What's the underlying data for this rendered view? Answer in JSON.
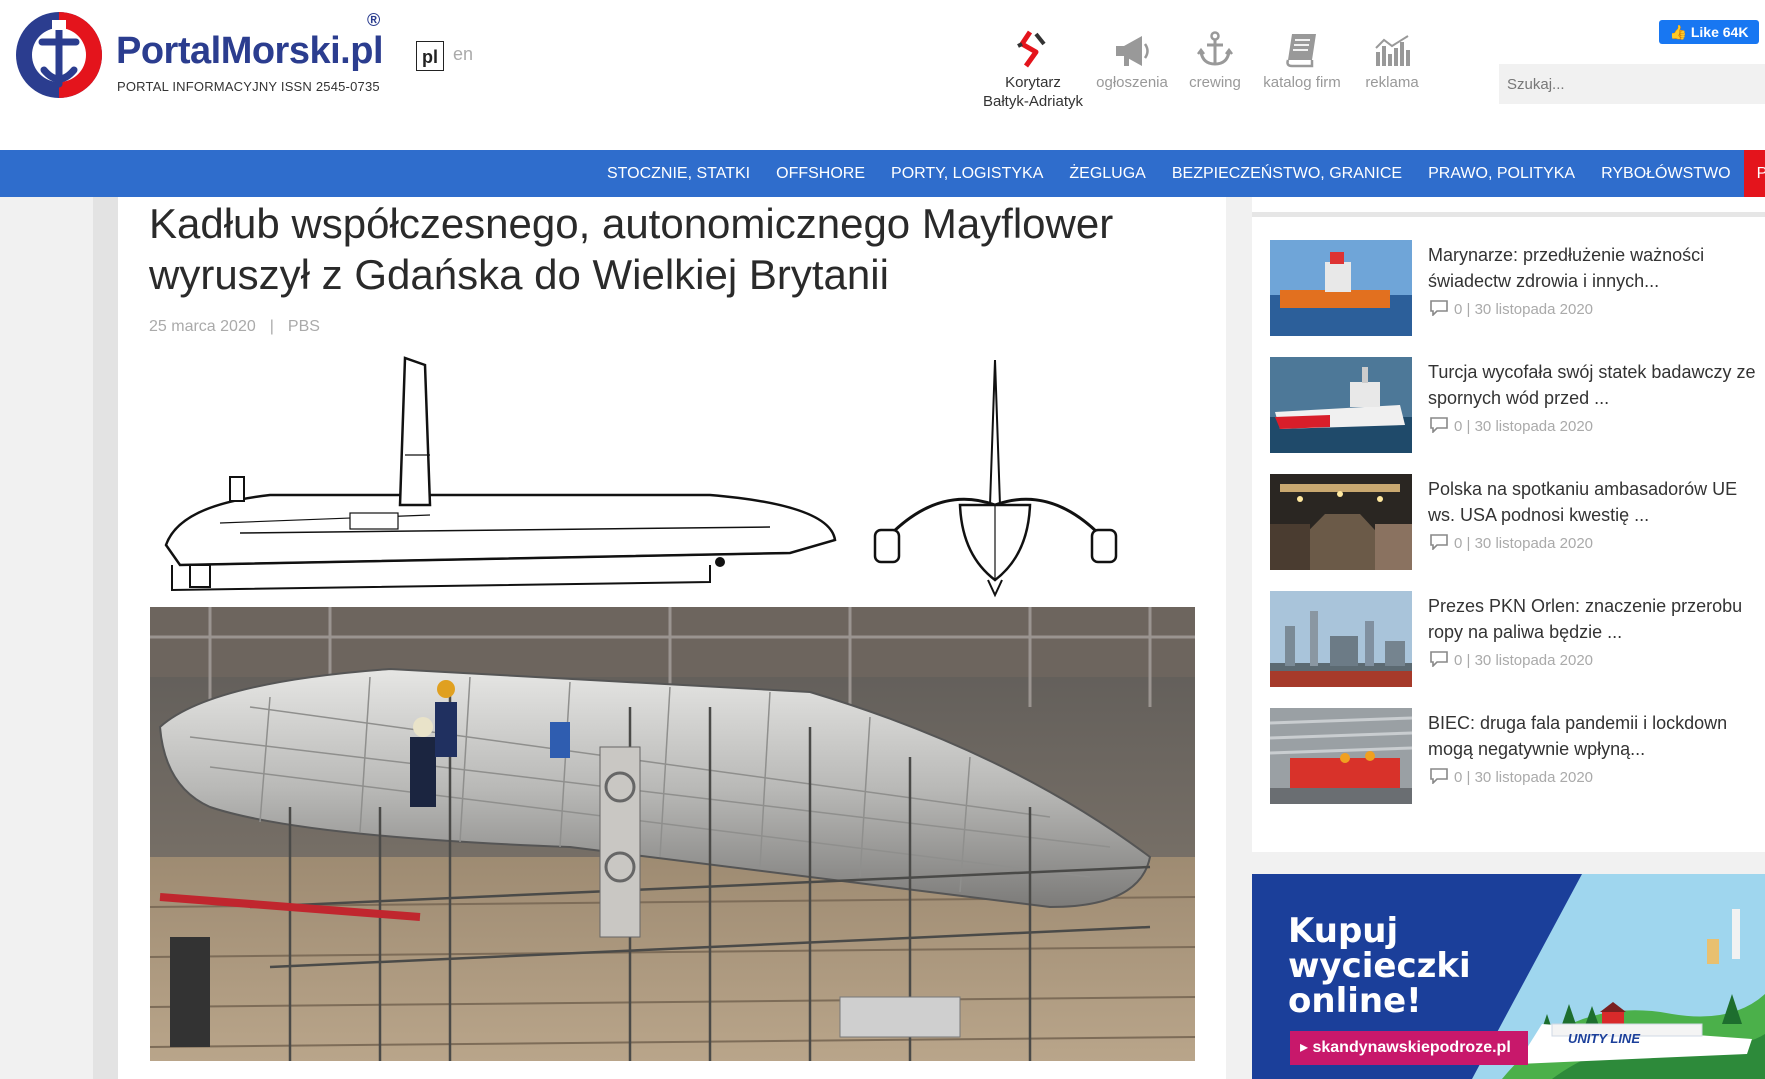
{
  "brand": {
    "name": "PortalMorski",
    "tld": ".pl",
    "registered": "®",
    "subtitle": "PORTAL INFORMACYJNY ISSN 2545-0735"
  },
  "languages": {
    "active": "pl",
    "other": "en"
  },
  "top_links": [
    {
      "label_1": "Korytarz",
      "label_2": "Bałtyk-Adriatyk",
      "icon": "korytarz-icon"
    },
    {
      "label": "ogłoszenia",
      "icon": "megaphone-icon"
    },
    {
      "label": "crewing",
      "icon": "anchor-icon"
    },
    {
      "label": "katalog firm",
      "icon": "book-icon"
    },
    {
      "label": "reklama",
      "icon": "bar-chart-icon"
    }
  ],
  "facebook": {
    "label": "Like 64K",
    "icon": "thumbs-up-icon"
  },
  "search": {
    "placeholder": "Szukaj..."
  },
  "nav": {
    "items": [
      "STOCZNIE, STATKI",
      "OFFSHORE",
      "PORTY, LOGISTYKA",
      "ŻEGLUGA",
      "BEZPIECZEŃSTWO, GRANICE",
      "PRAWO, POLITYKA",
      "RYBOŁÓWSTWO",
      "POL"
    ]
  },
  "article": {
    "title": "Kadłub współczesnego, autonomicznego Mayflower wyruszył z Gdańska do Wielkiej Brytanii",
    "date": "25 marca 2020",
    "separator": "|",
    "author": "PBS"
  },
  "sidebar": {
    "news": [
      {
        "title": "Marynarze: przedłużenie ważności świadectw zdrowia i innych...",
        "comments": "0",
        "date": "30 listopada 2020"
      },
      {
        "title": "Turcja wycofała swój statek badawczy ze spornych wód przed ...",
        "comments": "0",
        "date": "30 listopada 2020"
      },
      {
        "title": "Polska na spotkaniu ambasadorów UE ws. USA podnosi kwestię ...",
        "comments": "0",
        "date": "30 listopada 2020"
      },
      {
        "title": "Prezes PKN Orlen: znaczenie przerobu ropy na paliwa będzie ...",
        "comments": "0",
        "date": "30 listopada 2020"
      },
      {
        "title": "BIEC: druga fala pandemii i lockdown mogą negatywnie wpłyną...",
        "comments": "0",
        "date": "30 listopada 2020"
      }
    ],
    "meta_separator": "|"
  },
  "ad": {
    "line1": "Kupuj",
    "line2": "wycieczki",
    "line3": "online!",
    "url": "skandynawskiepodroze.pl",
    "ship_name": "UNITY LINE"
  },
  "colors": {
    "brand_blue": "#2b3d8f",
    "nav_blue": "#2f6dcc",
    "nav_red": "#e4141c",
    "ad_blue": "#1b3f9a",
    "ad_pink": "#c8186b"
  }
}
